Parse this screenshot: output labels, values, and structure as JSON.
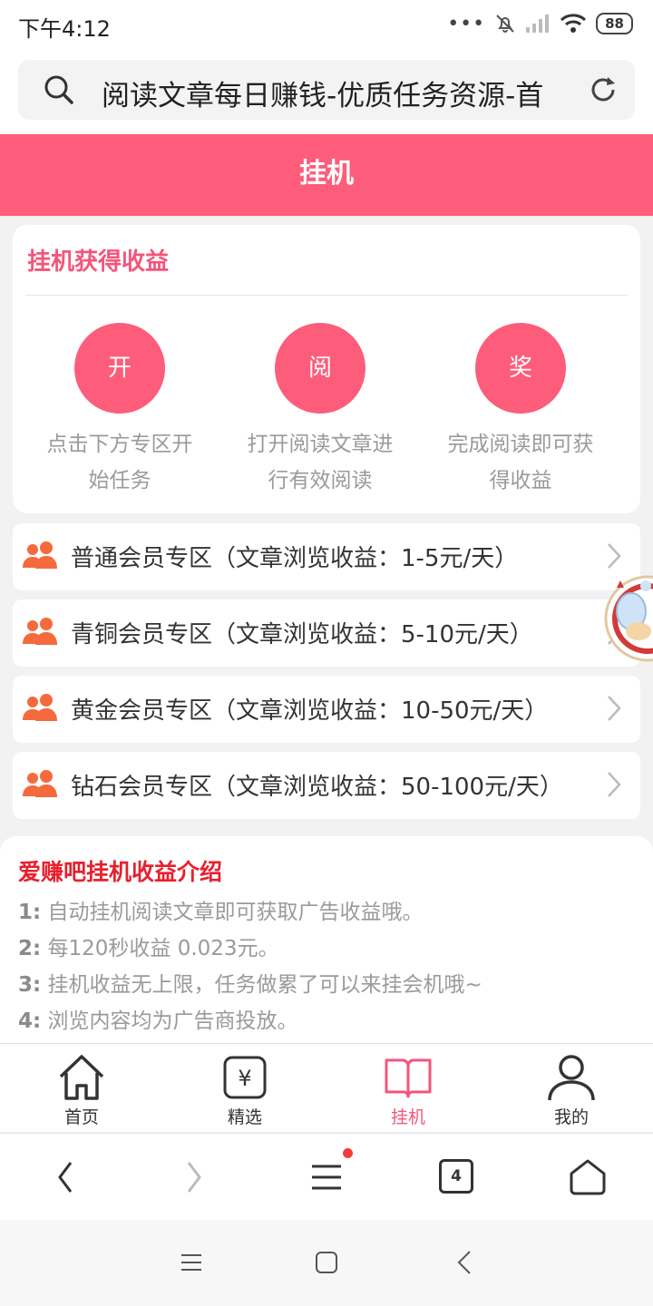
{
  "status_bar": {
    "time": "下午4:12",
    "battery": "88"
  },
  "address_bar": {
    "text": "阅读文章每日赚钱-优质任务资源-首"
  },
  "header": {
    "title": "挂机"
  },
  "steps_card": {
    "title": "挂机获得收益",
    "steps": [
      {
        "circle": "开",
        "line1": "点击下方专区开",
        "line2": "始任务"
      },
      {
        "circle": "阅",
        "line1": "打开阅读文章进",
        "line2": "行有效阅读"
      },
      {
        "circle": "奖",
        "line1": "完成阅读即可获",
        "line2": "得收益"
      }
    ]
  },
  "zones": [
    {
      "label": "普通会员专区（文章浏览收益：1-5元/天）"
    },
    {
      "label": "青铜会员专区（文章浏览收益：5-10元/天）"
    },
    {
      "label": "黄金会员专区（文章浏览收益：10-50元/天）"
    },
    {
      "label": "钻石会员专区（文章浏览收益：50-100元/天）"
    }
  ],
  "intro": {
    "title": "爱赚吧挂机收益介绍",
    "lines": [
      {
        "num": "1:",
        "text": " 自动挂机阅读文章即可获取广告收益哦。"
      },
      {
        "num": "2:",
        "text": " 每120秒收益 0.023元。"
      },
      {
        "num": "3:",
        "text": " 挂机收益无上限，任务做累了可以来挂会机哦~"
      },
      {
        "num": "4:",
        "text": " 浏览内容均为广告商投放。"
      }
    ]
  },
  "app_nav": {
    "items": [
      {
        "label": "首页",
        "icon": "home-icon"
      },
      {
        "label": "精选",
        "icon": "yen-icon"
      },
      {
        "label": "挂机",
        "icon": "book-icon",
        "active": true
      },
      {
        "label": "我的",
        "icon": "user-icon"
      }
    ]
  },
  "browser_bar": {
    "tab_count": "4"
  },
  "colors": {
    "accent": "#fd5d7a",
    "title_pink": "#f4557a",
    "intro_red": "#e8202e",
    "zone_icon": "#f56a3c"
  }
}
